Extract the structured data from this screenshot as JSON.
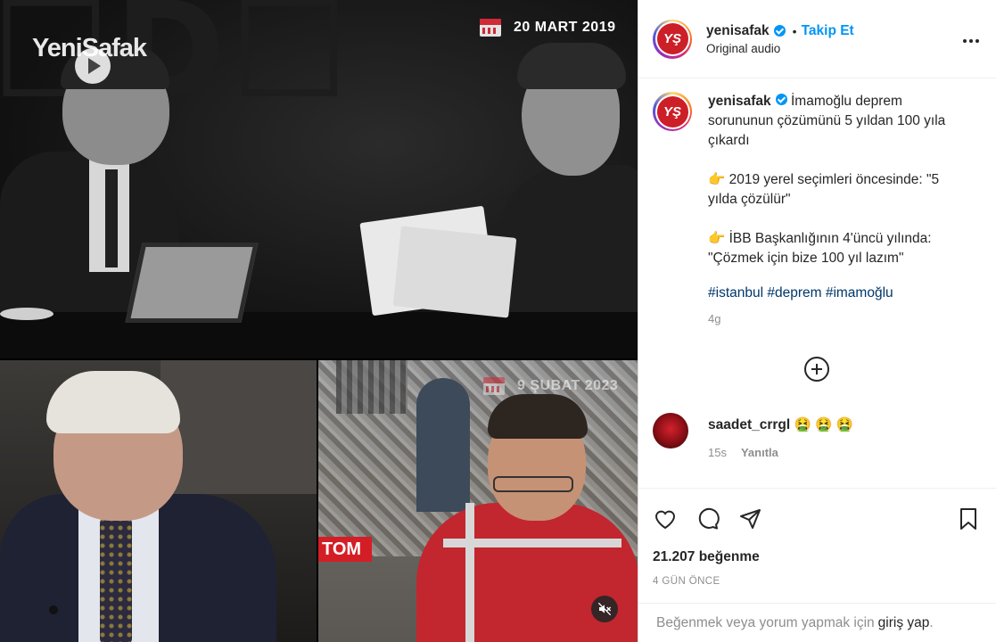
{
  "media": {
    "top_date": "20 MART 2019",
    "bottom_date": "9 ŞUBAT 2023",
    "brand_logo": "YeniSafak",
    "tv_logo": "TOM",
    "mute_icon": "mute-icon"
  },
  "header": {
    "username": "yenisafak",
    "separator": "•",
    "follow_label": "Takip Et",
    "subtitle": "Original audio",
    "avatar_text": "YŞ",
    "more_icon": "more-options-icon"
  },
  "caption": {
    "username": "yenisafak",
    "line1": "İmamoğlu deprem sorununun çözümünü 5 yıldan 100 yıla çıkardı",
    "line2": "👉 2019 yerel seçimleri öncesinde: \"5 yılda çözülür\"",
    "line3": "👉 İBB Başkanlığının 4'üncü yılında: \"Çözmek için bize 100 yıl lazım\"",
    "hashtags": "#istanbul #deprem #imamoğlu",
    "time": "4g"
  },
  "comment": {
    "username": "saadet_crrgl",
    "text": "🤮 🤮 🤮",
    "time": "15s",
    "reply_label": "Yanıtla"
  },
  "actions": {
    "likes": "21.207 beğenme",
    "date": "4 GÜN ÖNCE"
  },
  "login": {
    "prefix": "Beğenmek veya yorum yapmak için",
    "link": "giriş yap",
    "suffix": "."
  },
  "colors": {
    "accent": "#0095f6",
    "brand_red": "#cc1f28",
    "hashtag": "#00376b",
    "muted": "#8e8e8e"
  }
}
